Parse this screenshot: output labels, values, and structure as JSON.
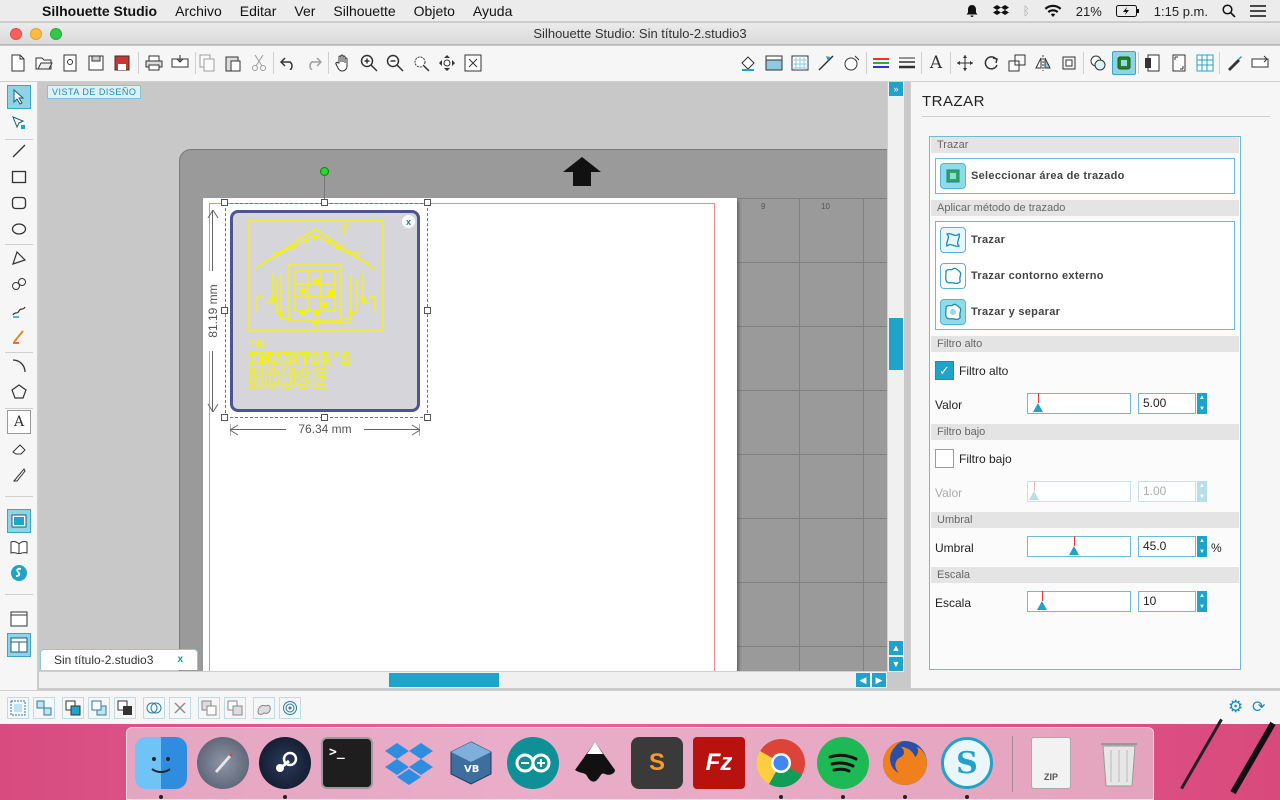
{
  "menubar": {
    "app_name": "Silhouette Studio",
    "items": [
      "Archivo",
      "Editar",
      "Ver",
      "Silhouette",
      "Objeto",
      "Ayuda"
    ],
    "battery": "21%",
    "clock": "1:15 p.m."
  },
  "window": {
    "title": "Silhouette Studio: Sin título-2.studio3"
  },
  "canvas": {
    "view_label": "VISTA DE DISEÑO",
    "ruler_numbers": [
      "9",
      "10"
    ],
    "height_dimension": "81.19 mm",
    "width_dimension": "76.34 mm",
    "image_close": "x",
    "logo_line1": "THE",
    "logo_line2": "INVENTOR'S",
    "logo_line3": "HOUSE"
  },
  "document_tab": {
    "label": "Sin título-2.studio3",
    "close": "x"
  },
  "panel": {
    "title": "TRAZAR",
    "sections": {
      "trazar": "Trazar",
      "metodo": "Aplicar método de trazado",
      "filtro_alto": "Filtro alto",
      "filtro_bajo": "Filtro bajo",
      "umbral": "Umbral",
      "escala": "Escala"
    },
    "select_area": "Seleccionar área de trazado",
    "methods": [
      "Trazar",
      "Trazar contorno externo",
      "Trazar y separar"
    ],
    "high_filter": {
      "checkbox_label": "Filtro alto",
      "checked": true,
      "value_label": "Valor",
      "value": "5.00",
      "level": 0.05
    },
    "low_filter": {
      "checkbox_label": "Filtro bajo",
      "checked": false,
      "value_label": "Valor",
      "value": "1.00",
      "level": 0.01
    },
    "threshold": {
      "label": "Umbral",
      "value": "45.0",
      "unit": "%",
      "level": 0.45
    },
    "scale": {
      "label": "Escala",
      "value": "10",
      "level": 0.1
    }
  },
  "colors": {
    "accent": "#1fa3c9",
    "logo_yellow": "#f4f20a",
    "image_border": "#4d5590",
    "cut_line": "#f08a8a"
  },
  "dock_apps": [
    "Finder",
    "Launchpad",
    "Steam",
    "Terminal",
    "Dropbox",
    "VirtualBox",
    "Arduino",
    "Inkscape",
    "Sublime Text",
    "FileZilla",
    "Chrome",
    "Spotify",
    "Firefox",
    "Silhouette Studio",
    "ZIP",
    "Papelera"
  ],
  "dock_icon_labels": {
    "terminal": ">_",
    "zip": "ZIP",
    "filezilla": "Fz",
    "sublime": "S",
    "silhouette": "S"
  }
}
